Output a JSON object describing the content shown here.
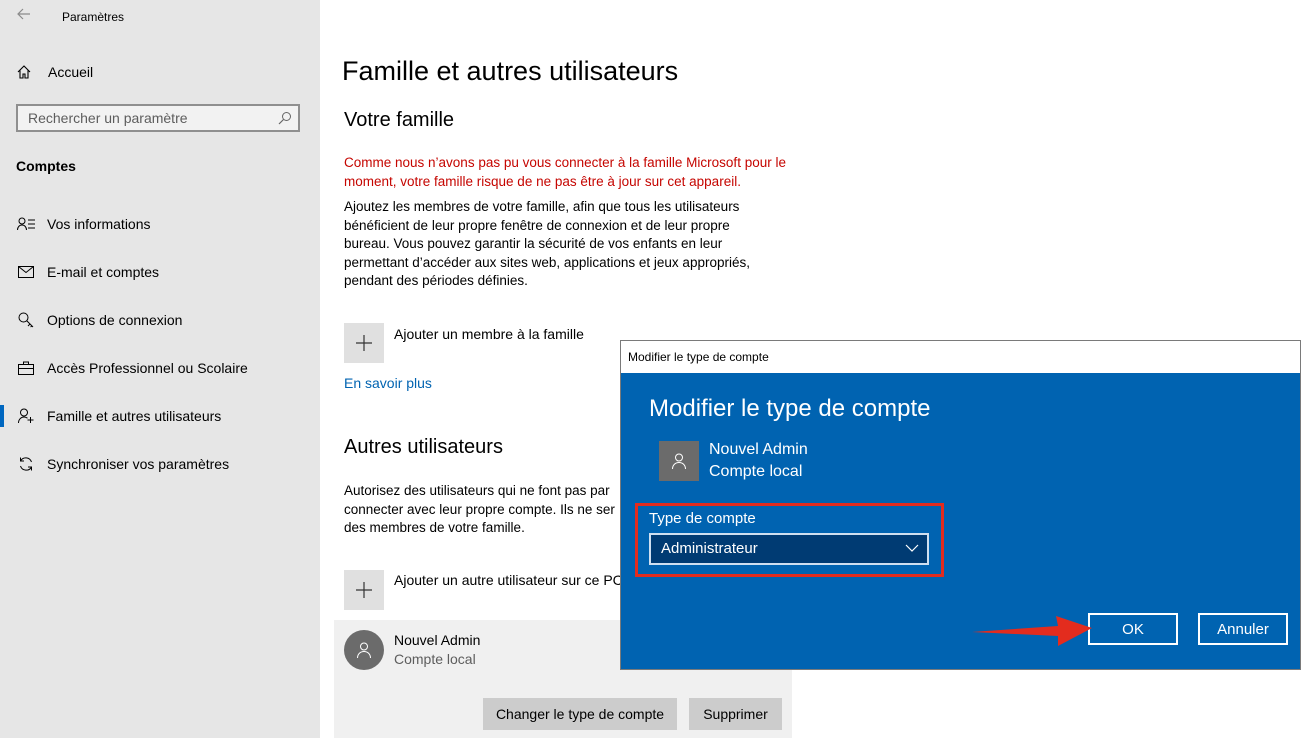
{
  "app": {
    "title": "Paramètres"
  },
  "sidebar": {
    "home_label": "Accueil",
    "search_placeholder": "Rechercher un paramètre",
    "section_label": "Comptes",
    "items": [
      {
        "label": "Vos informations",
        "icon": "person-list-icon"
      },
      {
        "label": "E-mail et comptes",
        "icon": "mail-icon"
      },
      {
        "label": "Options de connexion",
        "icon": "key-icon"
      },
      {
        "label": "Accès Professionnel ou Scolaire",
        "icon": "briefcase-icon"
      },
      {
        "label": "Famille et autres utilisateurs",
        "icon": "person-add-icon",
        "active": true
      },
      {
        "label": "Synchroniser vos paramètres",
        "icon": "sync-icon"
      }
    ]
  },
  "main": {
    "title": "Famille et autres utilisateurs",
    "family": {
      "heading": "Votre famille",
      "warning": "Comme nous n’avons pas pu vous connecter à la famille Microsoft pour le moment, votre famille risque de ne pas être à jour sur cet appareil.",
      "description": "Ajoutez les membres de votre famille, afin que tous les utilisateurs bénéficient de leur propre fenêtre de connexion et de leur propre bureau. Vous pouvez garantir la sécurité de vos enfants en leur permettant d’accéder aux sites web, applications et jeux appropriés, pendant des périodes définies.",
      "add_label": "Ajouter un membre à la famille",
      "learn_more": "En savoir plus"
    },
    "others": {
      "heading": "Autres utilisateurs",
      "description_visible": "Autorisez des utilisateurs qui ne font pas par connecter avec leur propre compte. Ils ne ser des membres de votre famille.",
      "add_label": "Ajouter un autre utilisateur sur ce PC",
      "user": {
        "name": "Nouvel Admin",
        "type": "Compte local"
      },
      "change_type_button": "Changer le type de compte",
      "delete_button": "Supprimer"
    }
  },
  "dialog": {
    "window_title": "Modifier le type de compte",
    "heading": "Modifier le type de compte",
    "user_name": "Nouvel Admin",
    "user_type": "Compte local",
    "account_type_label": "Type de compte",
    "account_type_value": "Administrateur",
    "ok_button": "OK",
    "cancel_button": "Annuler"
  },
  "colors": {
    "dialog_bg": "#0063b1",
    "highlight": "#e32c1e",
    "warning_text": "#c50500",
    "link": "#0063b1",
    "accent": "#0067c0"
  }
}
